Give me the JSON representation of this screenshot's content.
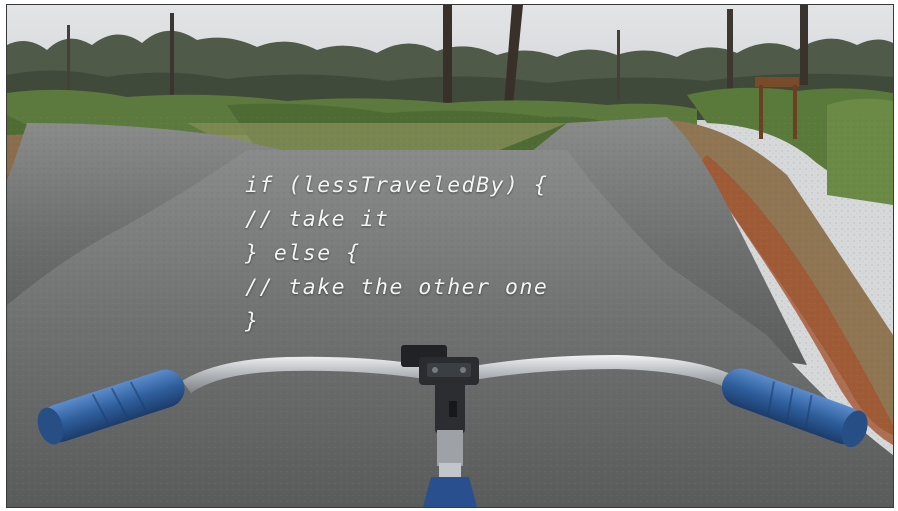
{
  "photo": {
    "subject": "bicycle handlebars at a fork in a paved trail through pine woods",
    "colors": {
      "sky": "#d9dcdf",
      "asphalt": "#6e6f6f",
      "grass_verge": "#8a6e4c",
      "pine_needles": "#a2542f",
      "palmetto": "#5c7a3e",
      "grip_blue": "#2f5f9d",
      "chrome": "#c9ccd0",
      "frame_blue": "#2a4f8f"
    }
  },
  "code_overlay": {
    "lines": [
      "if (lessTraveledBy) {",
      "// take it",
      "} else {",
      "// take the other one",
      "}"
    ]
  }
}
